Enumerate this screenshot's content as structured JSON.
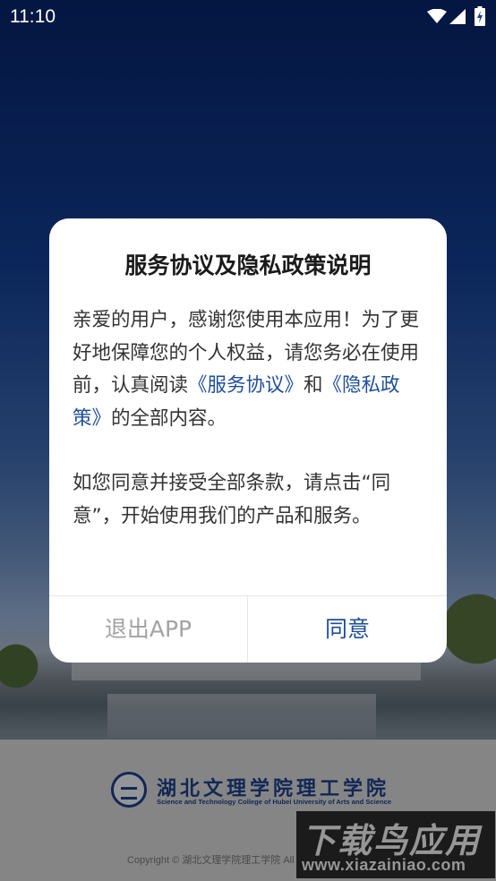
{
  "status_bar": {
    "time": "11:10"
  },
  "dialog": {
    "title": "服务协议及隐私政策说明",
    "para1_a": "亲爱的用户，感谢您使用本应用！为了更好地保障您的个人权益，请您务必在使用前，认真阅读",
    "link_service": "《服务协议》",
    "para1_and": "和",
    "link_privacy": "《隐私政策》",
    "para1_b": "的全部内容。",
    "para2": "如您同意并接受全部条款，请点击“同意”，开始使用我们的产品和服务。",
    "exit_label": "退出APP",
    "agree_label": "同意"
  },
  "brand": {
    "name_cn": "湖北文理学院理工学院",
    "name_en": "Science and Technology College of Hubei University of Arts and Science",
    "copyright": "Copyright © 湖北文理学院理工学院 All"
  },
  "watermark": {
    "text_cn": "下载鸟应用",
    "url": "www.xiazainiao.com"
  }
}
